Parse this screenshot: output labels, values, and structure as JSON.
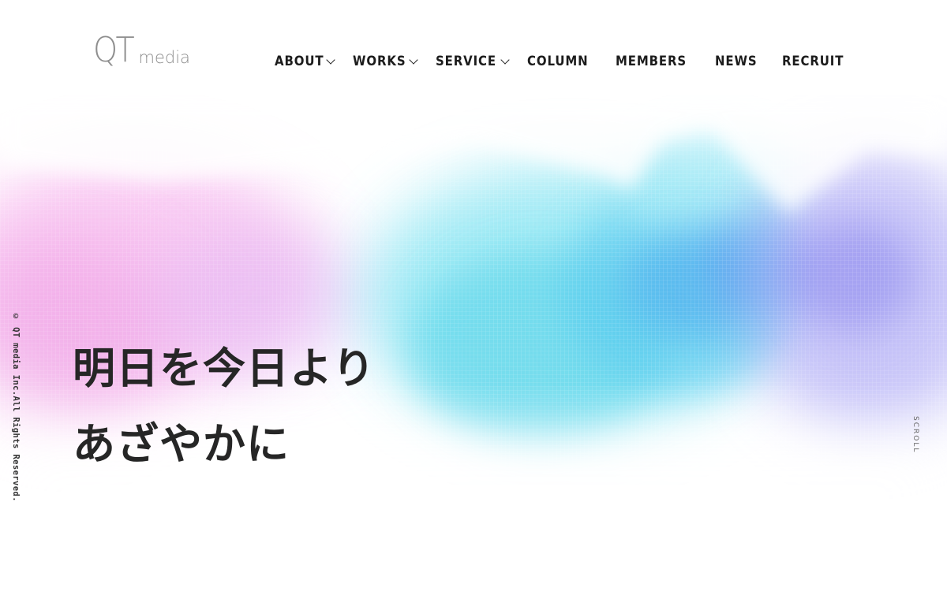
{
  "logo": {
    "main": "QT",
    "sub": "media"
  },
  "nav": {
    "items": [
      {
        "label": "ABOUT",
        "has_dropdown": true
      },
      {
        "label": "WORKS",
        "has_dropdown": true
      },
      {
        "label": "SERVICE",
        "has_dropdown": true
      },
      {
        "label": "COLUMN",
        "has_dropdown": false
      },
      {
        "label": "MEMBERS",
        "has_dropdown": false
      },
      {
        "label": "NEWS",
        "has_dropdown": false
      },
      {
        "label": "RECRUIT",
        "has_dropdown": false
      }
    ],
    "dropdown_icon": "chevron-down-icon"
  },
  "hero": {
    "headline_line1": "明日を今日より",
    "headline_line2": "あざやかに"
  },
  "copyright": "© QT media Inc.All Rights Reserved.",
  "scroll_label": "SCROLL",
  "colors": {
    "text_dark": "#262626",
    "logo_gray": "#8e8e8e",
    "watercolor_pink": "#f3a6e6",
    "watercolor_cyan": "#5fd6ea",
    "watercolor_blue": "#4fa8ee",
    "watercolor_violet": "#9a8cf0"
  }
}
